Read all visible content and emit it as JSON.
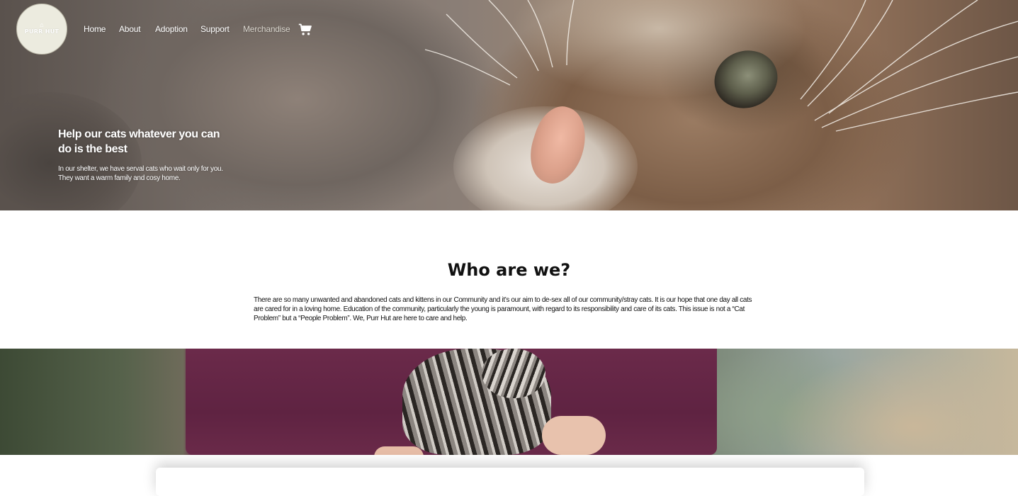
{
  "brand": {
    "name": "PURR HUT"
  },
  "nav": {
    "items": [
      {
        "label": "Home"
      },
      {
        "label": "About"
      },
      {
        "label": "Adoption"
      },
      {
        "label": "Support"
      },
      {
        "label": "Merchandise"
      }
    ],
    "cart_icon": "shopping-cart-icon"
  },
  "hero": {
    "title": "Help our cats whatever you can do is the best",
    "subtitle": "In our shelter, we have serval cats who wait only for you. They want a warm family and cosy home."
  },
  "about": {
    "heading": "Who are we?",
    "body": "There are so many unwanted and abandoned cats and kittens in our Community and it’s our aim to de-sex all of our community/stray cats. It is our hope that one day all cats are cared for in a loving home. Education of the community, particularly the young is paramount, with regard to its responsibility and care of its cats. This issue is not a “Cat Problem” but a “People Problem”. We, Purr Hut are here to care and help."
  },
  "colors": {
    "nav_text": "#ffffff",
    "heading_text": "#111111",
    "logo_bg": "#ecebdf"
  }
}
